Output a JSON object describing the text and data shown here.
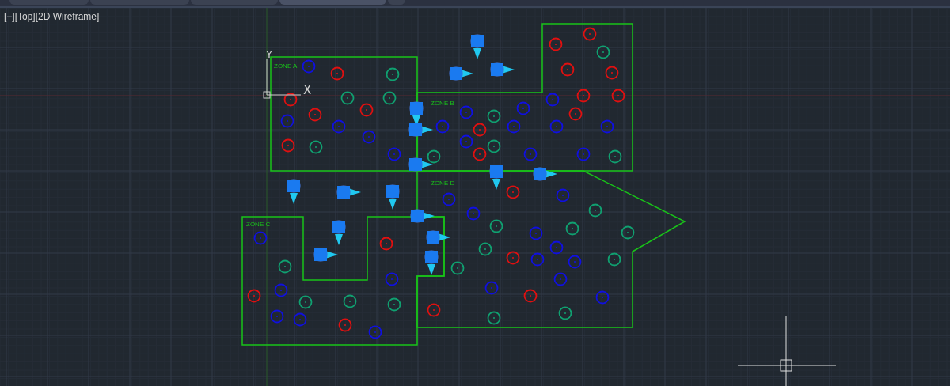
{
  "tabs": [
    {
      "selected": false
    },
    {
      "selected": false
    },
    {
      "selected": false
    },
    {
      "selected": true
    }
  ],
  "viewport": {
    "label": "[−][Top][2D Wireframe]"
  },
  "zones": [
    {
      "label": "ZONE A"
    },
    {
      "label": "ZONE B"
    },
    {
      "label": "ZONE C"
    },
    {
      "label": "ZONE D"
    }
  ],
  "ucs": {
    "x_label": "X",
    "y_label": "Y"
  }
}
